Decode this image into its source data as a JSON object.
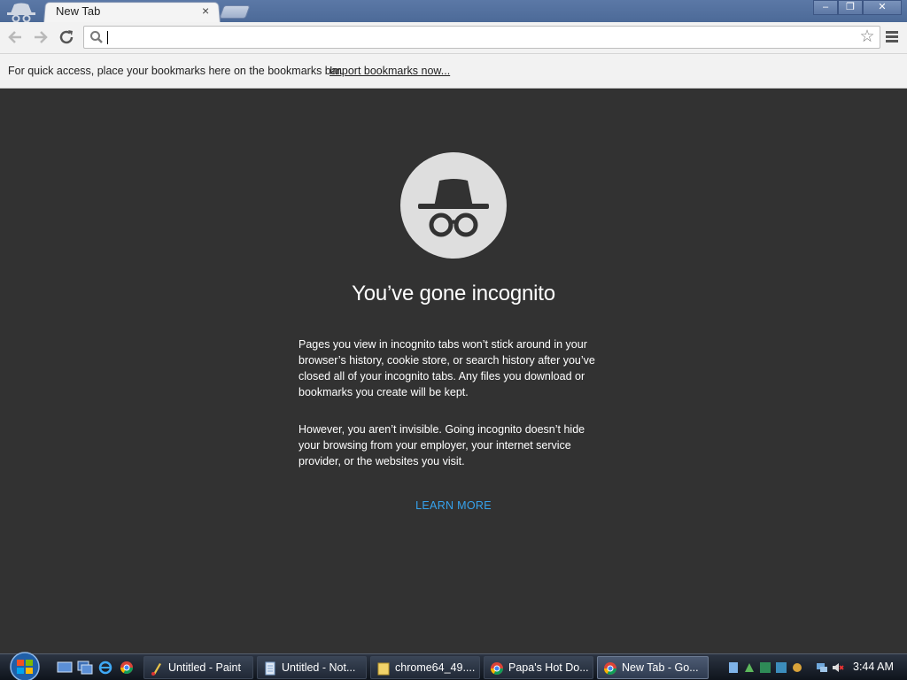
{
  "window": {
    "tab_title": "New Tab",
    "tab_close": "×",
    "controls": {
      "minimize": "–",
      "restore": "❐",
      "close": "✕"
    }
  },
  "toolbar": {
    "back_icon": "arrow-left-icon",
    "forward_icon": "arrow-right-icon",
    "reload_icon": "reload-icon",
    "omnibox_value": "",
    "star_icon": "star-icon",
    "menu_icon": "hamburger-menu-icon"
  },
  "bookmarks_bar": {
    "message": "For quick access, place your bookmarks here on the bookmarks bar.",
    "import_link": "Import bookmarks now..."
  },
  "incognito": {
    "heading": "You’ve gone incognito",
    "paragraph1": "Pages you view in incognito tabs won’t stick around in your browser’s history, cookie store, or search history after you’ve closed all of your incognito tabs. Any files you download or bookmarks you create will be kept.",
    "paragraph2": "However, you aren’t invisible. Going incognito doesn’t hide your browsing from your employer, your internet service provider, or the websites you visit.",
    "learn_more": "LEARN MORE",
    "colors": {
      "background": "#323232",
      "link": "#36a3ee",
      "icon_circle": "#dedede"
    }
  },
  "taskbar": {
    "buttons": [
      {
        "label": "Untitled - Paint",
        "icon": "paint-icon"
      },
      {
        "label": "Untitled - Not...",
        "icon": "notepad-icon"
      },
      {
        "label": "chrome64_49....",
        "icon": "folder-icon"
      },
      {
        "label": "Papa's Hot Do...",
        "icon": "chrome-icon"
      },
      {
        "label": "New Tab - Go...",
        "icon": "chrome-icon"
      }
    ],
    "clock": "3:44 AM"
  }
}
